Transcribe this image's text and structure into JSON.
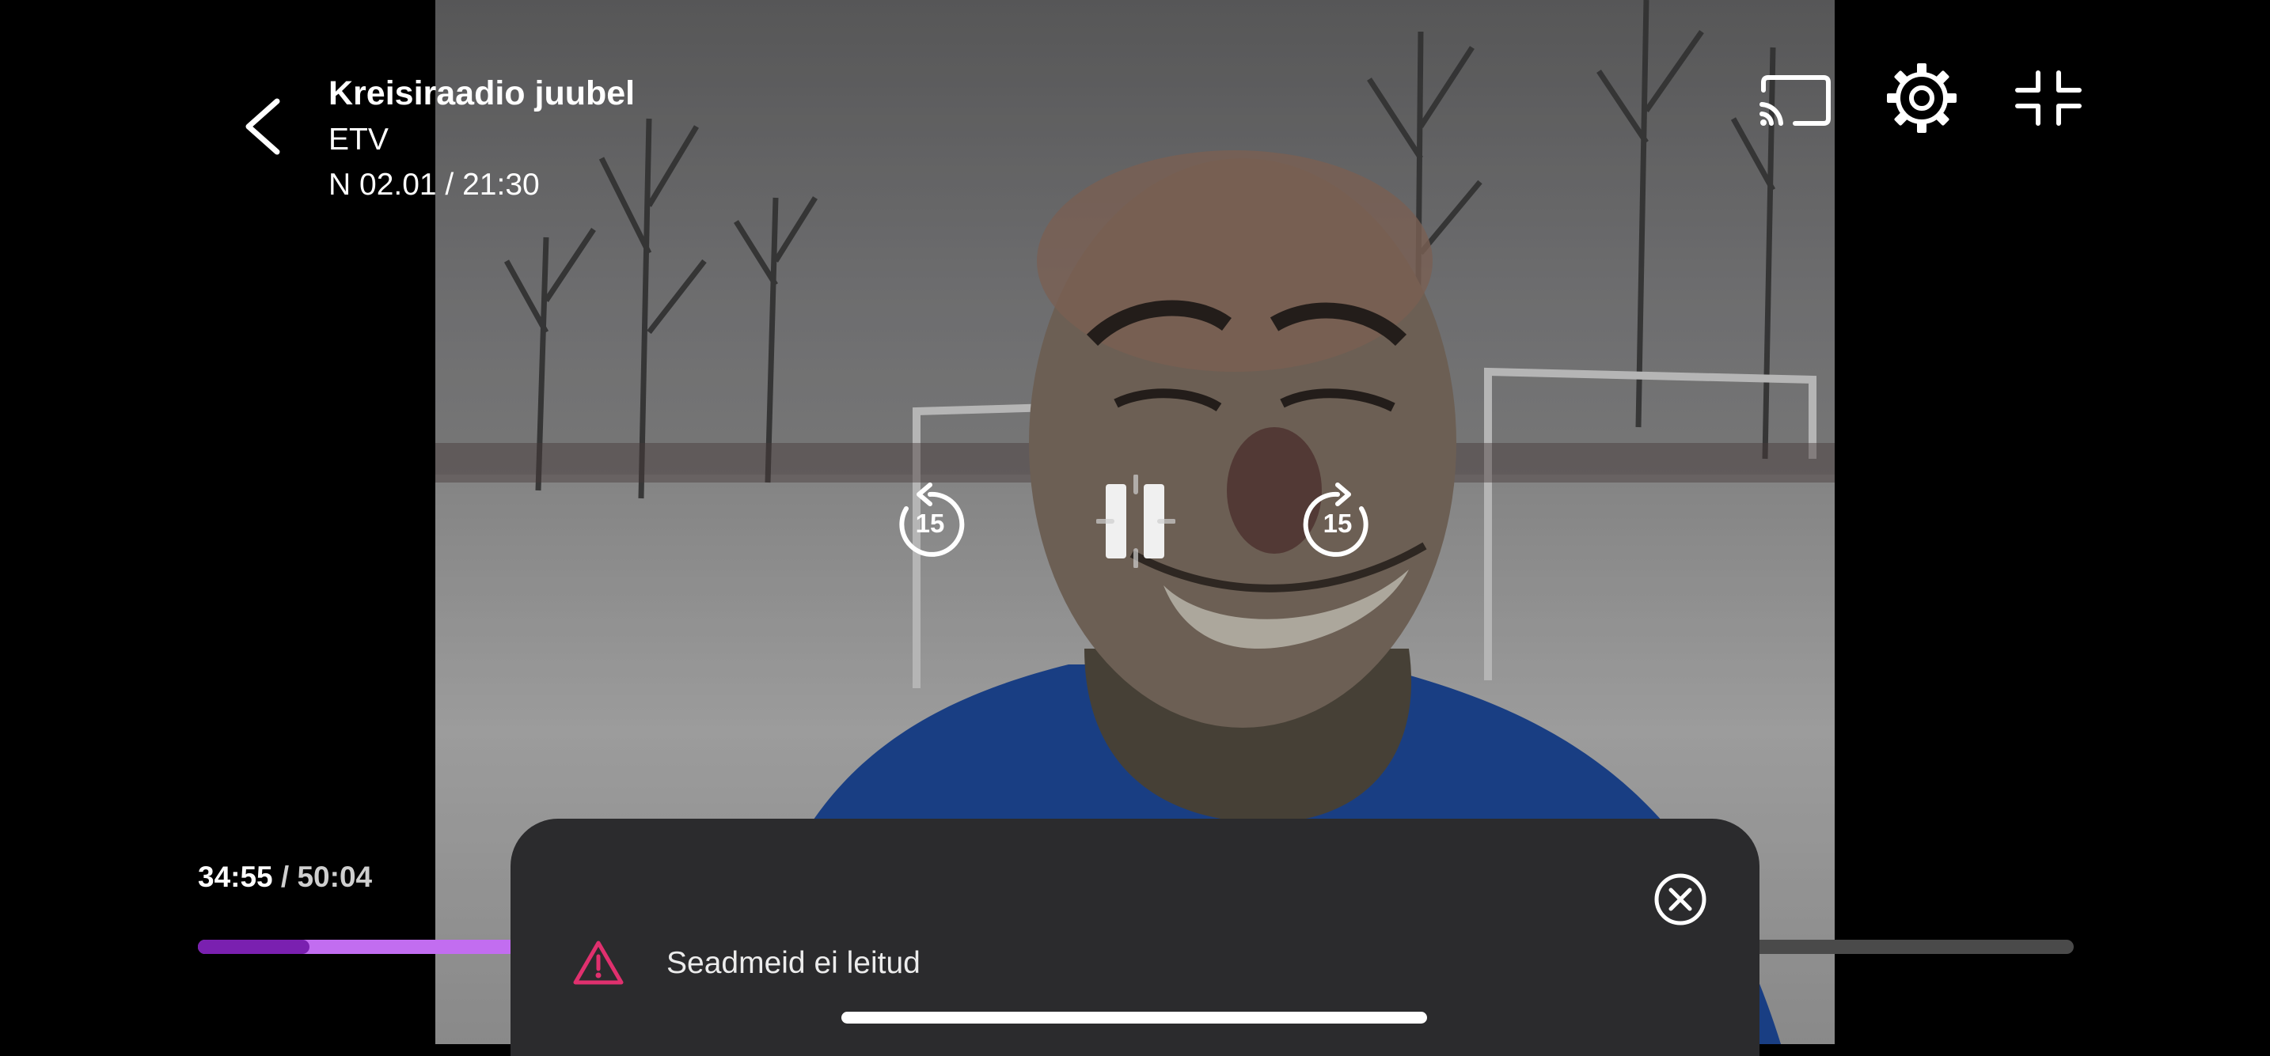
{
  "program": {
    "title": "Kreisiraadio juubel",
    "channel": "ETV",
    "airtime": "N 02.01 / 21:30"
  },
  "player": {
    "elapsed": "34:55",
    "separator": "/",
    "duration": "50:04",
    "progress_played": 0.0595,
    "progress_buffered": 0.17,
    "skip_back_label": "15",
    "skip_forward_label": "15",
    "state": "paused-loading"
  },
  "icons": {
    "back": "chevron-left-icon",
    "cast": "cast-icon",
    "settings": "gear-icon",
    "exit_fullscreen": "exit-fullscreen-icon",
    "close": "close-circle-icon",
    "warning": "warning-triangle-icon"
  },
  "cast_sheet": {
    "message": "Seadmeid ei leitud"
  },
  "colors": {
    "progress_played": "#7a20b0",
    "progress_buffered": "#c26df0",
    "warning": "#e0306e",
    "sheet_bg": "#2b2b2d"
  }
}
